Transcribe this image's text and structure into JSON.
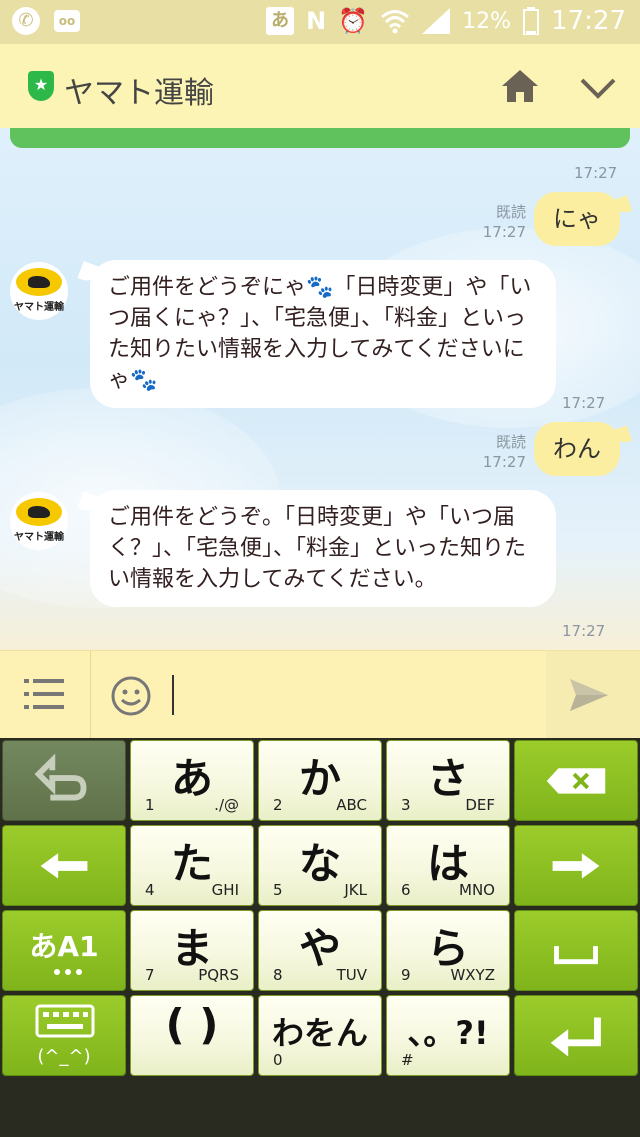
{
  "status_bar": {
    "ime_glyph": "あ",
    "battery": "12%",
    "time": "17:27",
    "icons": [
      "phone-icon",
      "voicemail-icon",
      "ime-icon",
      "nfc-icon",
      "alarm-icon",
      "wifi-icon",
      "signal-icon",
      "battery-icon"
    ]
  },
  "header": {
    "title": "ヤマト運輸",
    "badge_icon": "verified-shield-icon",
    "home_icon": "home-icon",
    "menu_icon": "chevron-down-icon"
  },
  "chat": {
    "top_timestamp": "17:27",
    "messages": [
      {
        "from": "me",
        "text": "にゃ",
        "read_label": "既読",
        "time": "17:27"
      },
      {
        "from": "bot",
        "avatar_label": "ヤマト運輸",
        "text": "ご用件をどうぞにゃ🐾「日時変更」や「いつ届くにゃ？」、「宅急便」、「料金」といった知りたい情報を入力してみてくださいにゃ🐾",
        "time": "17:27"
      },
      {
        "from": "me",
        "text": "わん",
        "read_label": "既読",
        "time": "17:27"
      },
      {
        "from": "bot",
        "avatar_label": "ヤマト運輸",
        "text": "ご用件をどうぞ。「日時変更」や「いつ届く？」、「宅急便」、「料金」といった知りたい情報を入力してみてください。",
        "time": "17:27"
      }
    ]
  },
  "input_bar": {
    "value": "",
    "menu_icon": "menu-list-icon",
    "emoji_icon": "emoji-icon",
    "send_icon": "send-icon"
  },
  "keyboard": {
    "rows": [
      [
        {
          "type": "side",
          "icon": "undo-icon"
        },
        {
          "type": "kana",
          "main": "あ",
          "num": "1",
          "sub": "./@"
        },
        {
          "type": "kana",
          "main": "か",
          "num": "2",
          "sub": "ABC"
        },
        {
          "type": "kana",
          "main": "さ",
          "num": "3",
          "sub": "DEF"
        },
        {
          "type": "side",
          "icon": "backspace-icon"
        }
      ],
      [
        {
          "type": "side",
          "icon": "arrow-left-icon"
        },
        {
          "type": "kana",
          "main": "た",
          "num": "4",
          "sub": "GHI"
        },
        {
          "type": "kana",
          "main": "な",
          "num": "5",
          "sub": "JKL"
        },
        {
          "type": "kana",
          "main": "は",
          "num": "6",
          "sub": "MNO"
        },
        {
          "type": "side",
          "icon": "arrow-right-icon"
        }
      ],
      [
        {
          "type": "side",
          "main": "あA1",
          "icon": "mode-switch-icon"
        },
        {
          "type": "kana",
          "main": "ま",
          "num": "7",
          "sub": "PQRS"
        },
        {
          "type": "kana",
          "main": "や",
          "num": "8",
          "sub": "TUV"
        },
        {
          "type": "kana",
          "main": "ら",
          "num": "9",
          "sub": "WXYZ"
        },
        {
          "type": "side",
          "icon": "space-icon"
        }
      ],
      [
        {
          "type": "side",
          "main": "(^_^)",
          "icon": "keyboard-settings-icon"
        },
        {
          "type": "kana",
          "main": "( )",
          "num": "",
          "sub": ""
        },
        {
          "type": "kana",
          "main": "わをん",
          "num": "0",
          "sub": ""
        },
        {
          "type": "kana",
          "main": "、。?!",
          "num": "#",
          "sub": ""
        },
        {
          "type": "side",
          "icon": "enter-icon"
        }
      ]
    ]
  }
}
